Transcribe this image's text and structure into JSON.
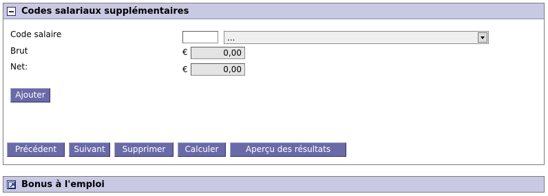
{
  "panel1": {
    "title": "Codes salariaux supplémentaires",
    "toggle_icon": "collapse-icon",
    "fields": {
      "code_salaire_label": "Code salaire",
      "code_value": "",
      "select_value": "...",
      "brut_label": "Brut",
      "net_label": "Net:",
      "currency": "€",
      "brut_value": "0,00",
      "net_value": "0,00"
    },
    "buttons": {
      "ajouter": "Ajouter",
      "precedent": "Précédent",
      "suivant": "Suivant",
      "supprimer": "Supprimer",
      "calculer": "Calculer",
      "apercu": "Aperçu des résultats"
    }
  },
  "panel2": {
    "title": "Bonus à l'emploi",
    "toggle_icon": "expand-icon"
  },
  "colors": {
    "header_bg": "#c9c9e4",
    "button_bg": "#6a6aa8",
    "readonly_bg": "#e4e4e4"
  }
}
